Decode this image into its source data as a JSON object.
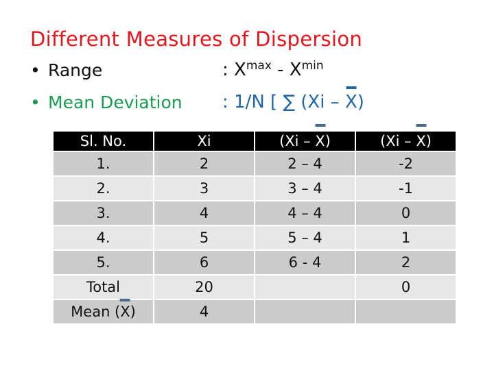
{
  "title": "Different Measures of Dispersion",
  "bullets": [
    {
      "label": "Range",
      "formula_prefix": ": X",
      "sup1": "max",
      "middle": " - X",
      "sup2": "min"
    },
    {
      "label": "Mean Deviation",
      "formula_prefix": ": 1/N [ ∑ (Xi – ",
      "xbar": "X",
      "formula_suffix": ")"
    }
  ],
  "colors": {
    "title": "#e8141c",
    "range": "#111111",
    "mean_deviation": "#1a9a50",
    "formula_blue": "#2166a8"
  },
  "table": {
    "headers": [
      {
        "text": "Sl. No."
      },
      {
        "text": "Xi"
      },
      {
        "pre": "(Xi – ",
        "bar": "X",
        "post": ")"
      },
      {
        "pre": "(Xi – ",
        "bar": "X",
        "post": ")"
      }
    ],
    "rows": [
      [
        "1.",
        "2",
        "2 – 4",
        "-2"
      ],
      [
        "2.",
        "3",
        "3 – 4",
        "-1"
      ],
      [
        "3.",
        "4",
        "4 – 4",
        "0"
      ],
      [
        "4.",
        "5",
        "5 – 4",
        "1"
      ],
      [
        "5.",
        "6",
        "6 - 4",
        "2"
      ],
      [
        "Total",
        "20",
        "",
        "0"
      ]
    ],
    "mean_row": {
      "pre": "Mean (",
      "bar": "X",
      "post": ")",
      "xi": "4",
      "c3": "",
      "c4": ""
    }
  }
}
